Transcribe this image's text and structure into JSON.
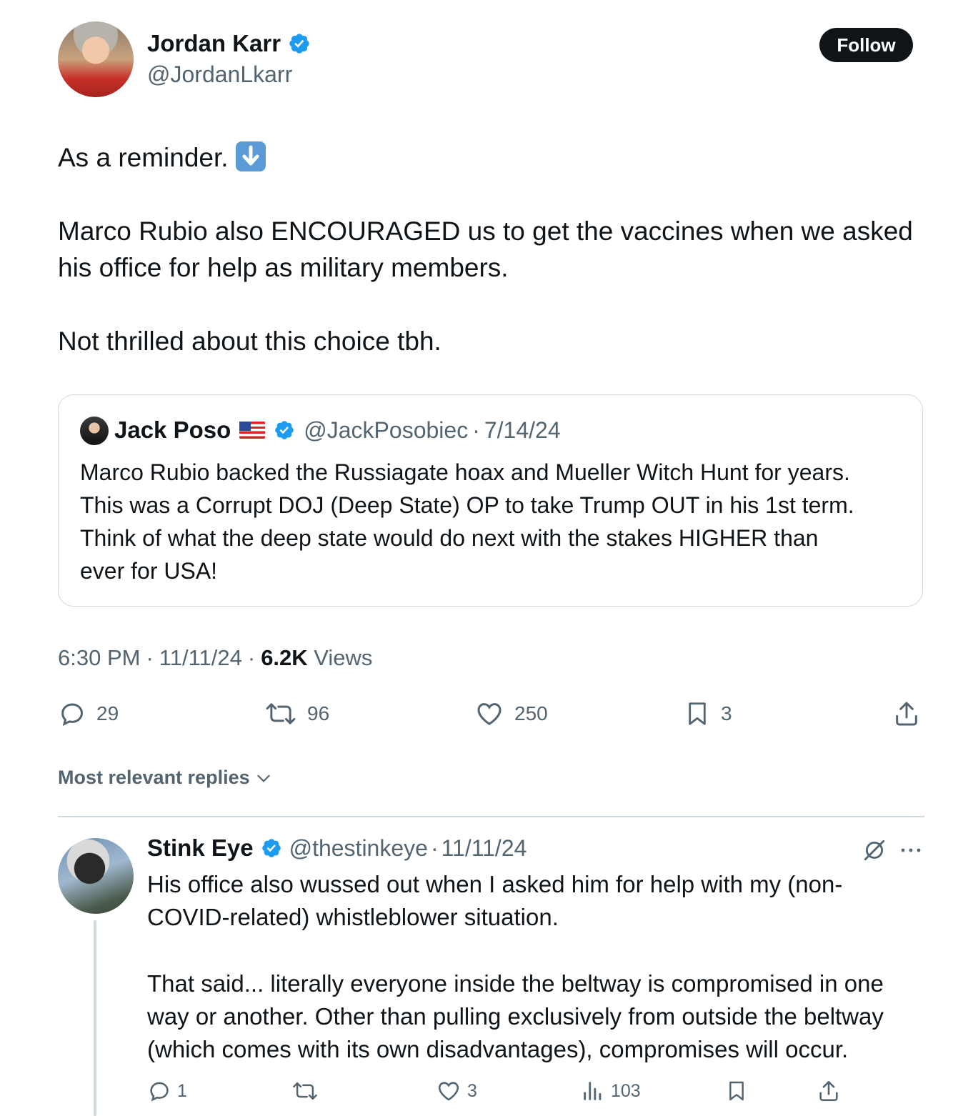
{
  "tweet": {
    "author": {
      "name": "Jordan Karr",
      "handle": "@JordanLkarr"
    },
    "follow_label": "Follow",
    "text_line1": "As a reminder.",
    "text_line2": "Marco Rubio also ENCOURAGED us to get the vaccines when we asked",
    "text_line3": "his office for help as military members.",
    "text_line4": "Not thrilled about this choice tbh.",
    "quote": {
      "name": "Jack Poso",
      "handle": "@JackPosobiec",
      "sep": "·",
      "date": "7/14/24",
      "line1": "Marco Rubio backed the Russiagate hoax and Mueller Witch Hunt for years.",
      "line2": "This was a Corrupt DOJ (Deep State) OP to take Trump OUT in his 1st term.",
      "line3": "Think of what the deep state would do next with the stakes HIGHER than",
      "line4": "ever for USA!"
    },
    "time": "6:30 PM",
    "sep": "·",
    "date": "11/11/24",
    "views_count": "6.2K",
    "views_label": "Views",
    "stats": {
      "replies": "29",
      "reposts": "96",
      "likes": "250",
      "bookmarks": "3"
    }
  },
  "replies_sort": {
    "label": "Most relevant replies"
  },
  "reply": {
    "name": "Stink Eye",
    "handle": "@thestinkeye",
    "sep": "·",
    "date": "11/11/24",
    "line1": "His office also wussed out when I asked him for help with my (non-",
    "line2": "COVID-related) whistleblower situation.",
    "line3": "That said... literally everyone inside the beltway is compromised in one",
    "line4": "way or another.  Other than pulling exclusively from outside the beltway",
    "line5": "(which comes with its own disadvantages), compromises will occur.",
    "stats": {
      "replies": "1",
      "likes": "3",
      "views": "103"
    }
  },
  "icons": {
    "verified_color": "#1d9bf0",
    "emoji": "down-arrow-emoji",
    "flag": "us-flag-emoji"
  }
}
